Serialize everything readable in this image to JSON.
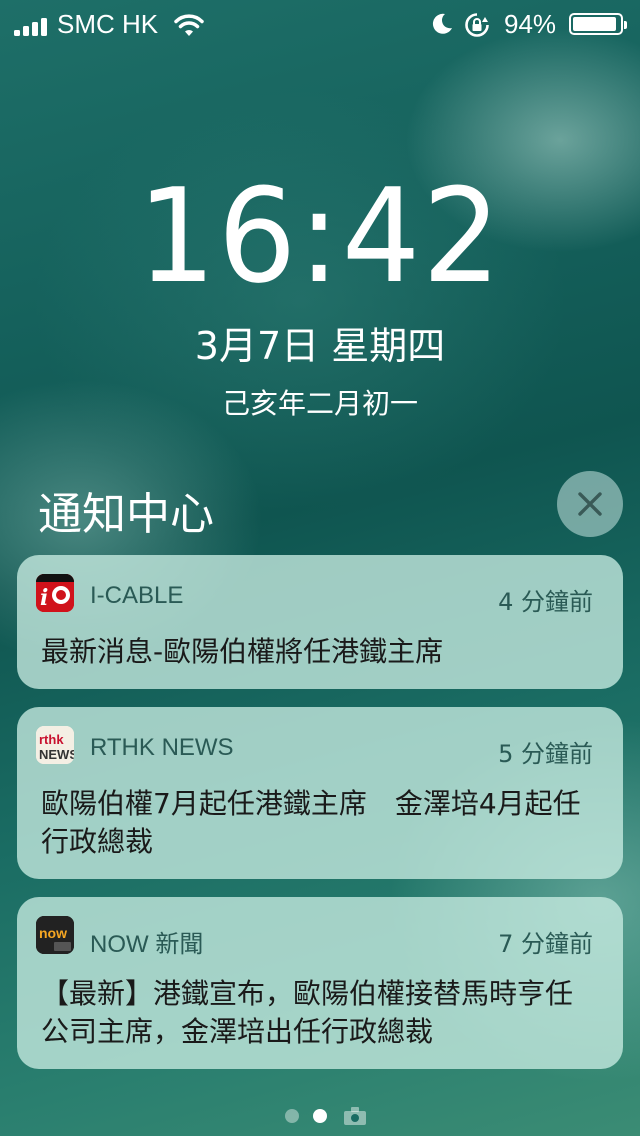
{
  "status_bar": {
    "carrier": "SMC HK",
    "battery_percent": "94%",
    "battery_level": 0.94,
    "icons": [
      "signal-icon",
      "wifi-icon",
      "moon-icon",
      "rotation-lock-icon",
      "battery-icon"
    ]
  },
  "lock_screen": {
    "time": "16:42",
    "date": "3月7日 星期四",
    "lunar_date": "己亥年二月初一"
  },
  "notification_center": {
    "title": "通知中心",
    "close_icon": "close-icon"
  },
  "notifications": [
    {
      "app": "I-CABLE",
      "time_ago": "4 分鐘前",
      "message": "最新消息-歐陽伯權將任港鐵主席",
      "icon": "i-cable-app-icon",
      "icon_color": "#d0121b"
    },
    {
      "app": "RTHK NEWS",
      "time_ago": "5 分鐘前",
      "message": "歐陽伯權7月起任港鐵主席　金澤培4月起任行政總裁",
      "icon": "rthk-news-app-icon",
      "icon_color": "#f4efe4"
    },
    {
      "app": "NOW 新聞",
      "time_ago": "7 分鐘前",
      "message": "【最新】港鐵宣布，歐陽伯權接替馬時亨任公司主席，金澤培出任行政總裁",
      "icon": "now-news-app-icon",
      "icon_color": "#222222"
    }
  ],
  "page_indicator": {
    "pages": 3,
    "current": 2
  },
  "colors": {
    "card_bg": "#c8ece2",
    "secondary_text": "#2a5a55"
  }
}
